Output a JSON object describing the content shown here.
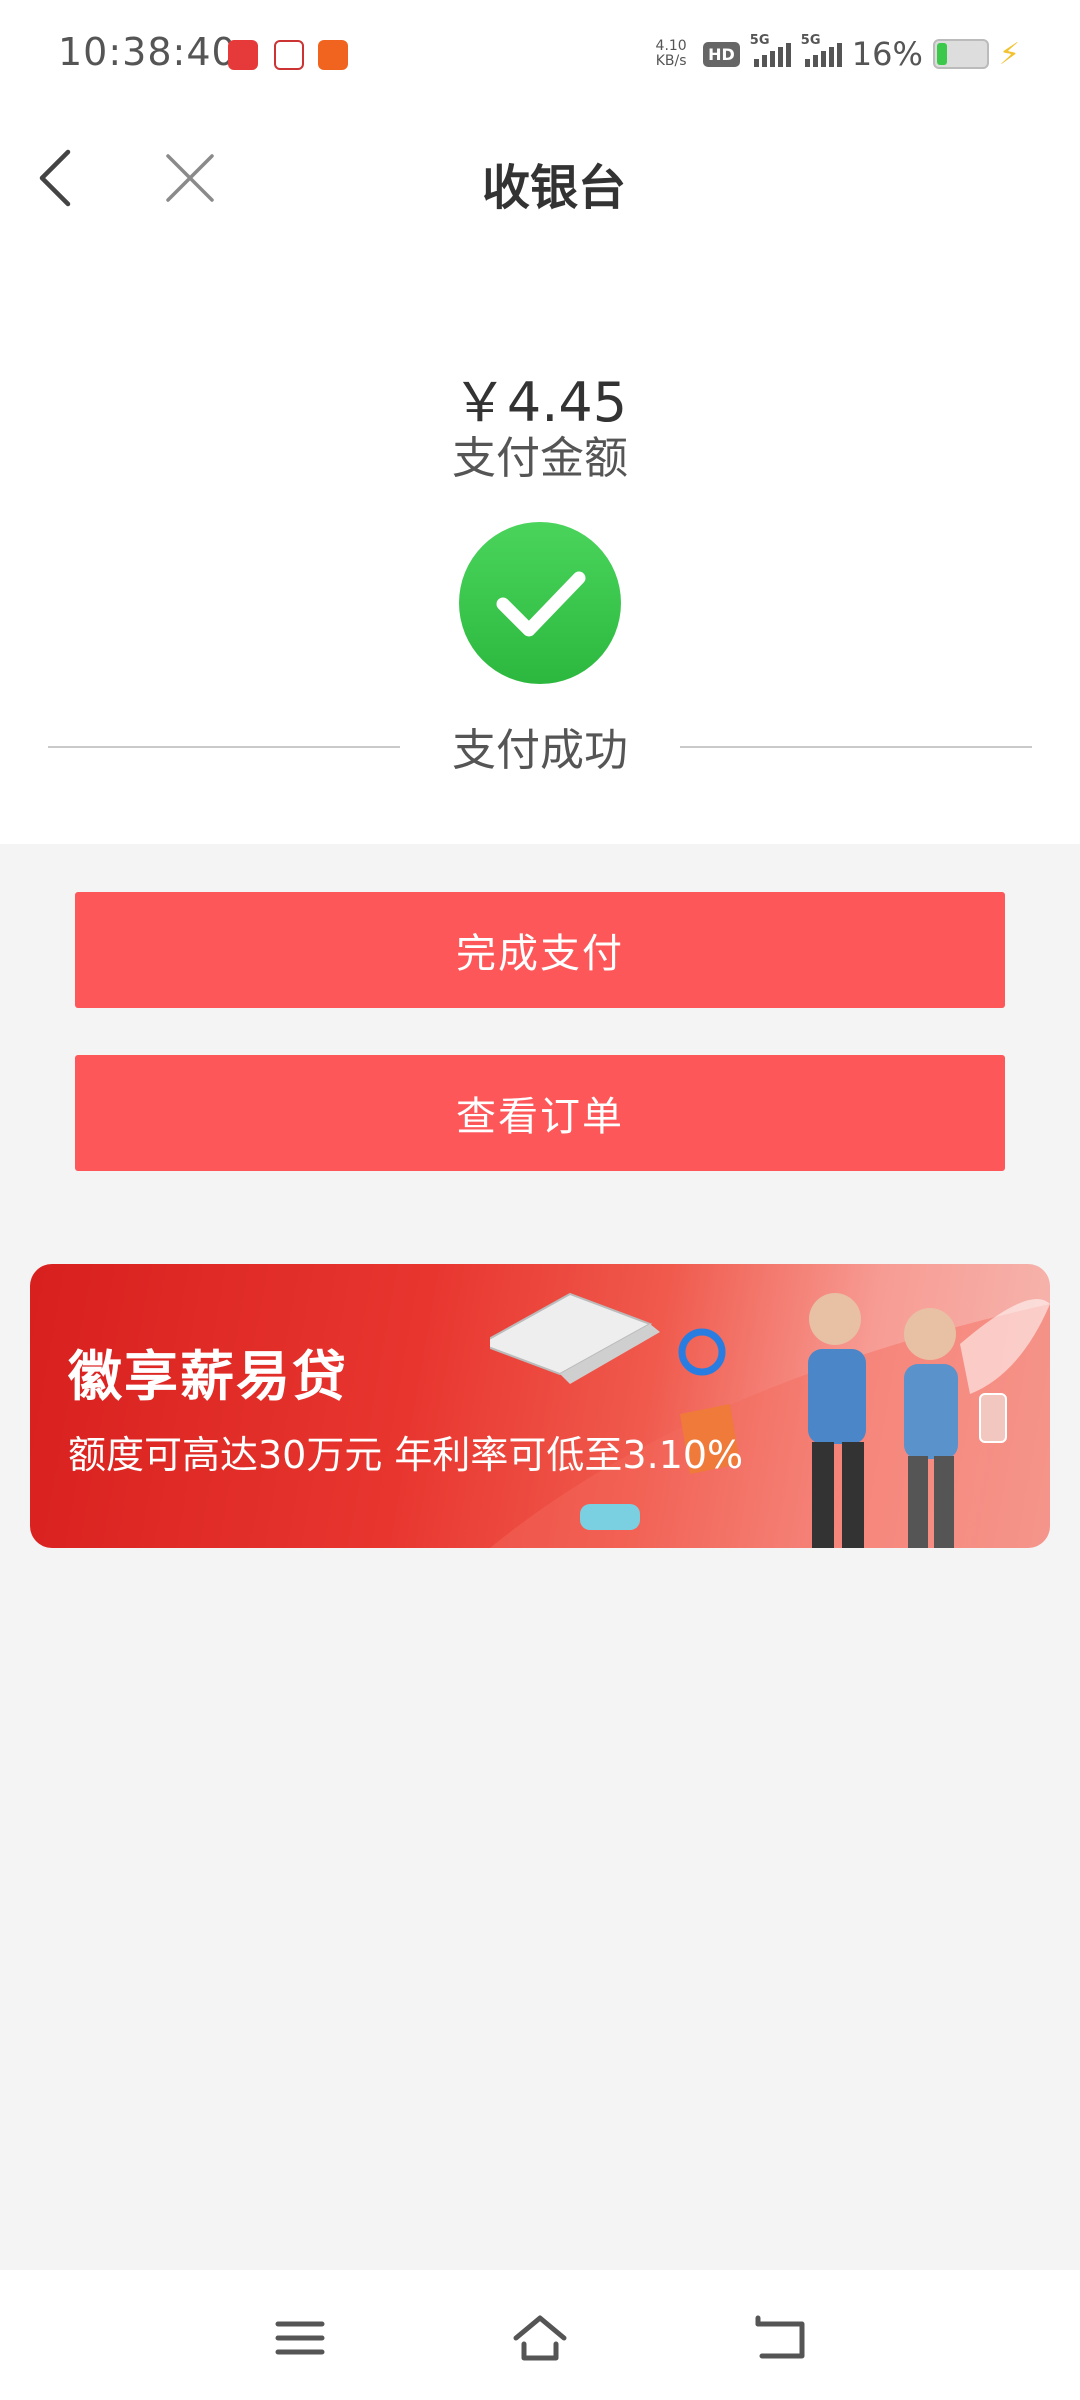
{
  "status_bar": {
    "time": "10:38:40",
    "net_speed_value": "4.10",
    "net_speed_unit": "KB/s",
    "hd_label": "HD",
    "signal1_label": "5G",
    "signal2_label": "5G",
    "battery_percent": "16%",
    "notification_icons": [
      "app-notification-icon-1",
      "app-notification-icon-2",
      "bank-notification-icon"
    ]
  },
  "header": {
    "title": "收银台",
    "back_icon": "chevron-left-icon",
    "close_icon": "close-icon"
  },
  "payment": {
    "amount": "￥4.45",
    "amount_label": "支付金额",
    "status": "支付成功",
    "status_icon": "check-circle-icon",
    "status_color": "#3cc74d"
  },
  "buttons": {
    "complete": "完成支付",
    "view_order": "查看订单",
    "color": "#fd575a"
  },
  "banner": {
    "title": "徽享薪易贷",
    "subtitle": "额度可高达30万元  年利率可低至3.10%"
  },
  "nav_bar": {
    "menu_icon": "menu-icon",
    "home_icon": "home-icon",
    "back_icon": "back-icon"
  }
}
